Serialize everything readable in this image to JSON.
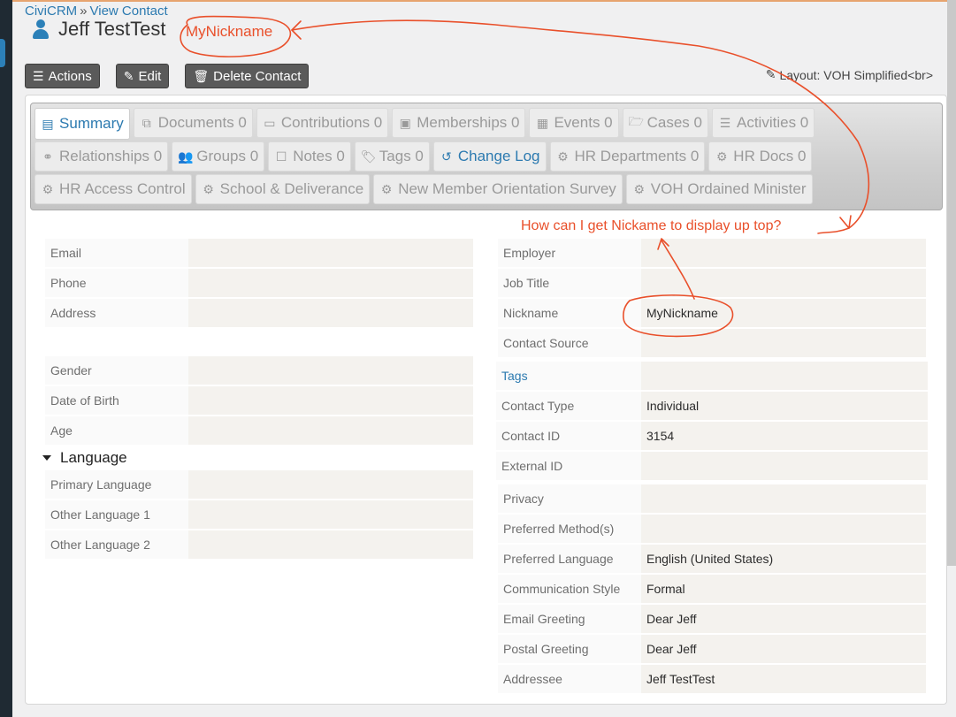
{
  "breadcrumb": {
    "root": "CiviCRM",
    "separator": "»",
    "current": "View Contact"
  },
  "contact": {
    "display_name": "Jeff TestTest"
  },
  "toolbar": {
    "actions_label": "Actions",
    "edit_label": "Edit",
    "delete_label": "Delete Contact",
    "layout_label": "Layout: VOH Simplified<br>"
  },
  "tabs": [
    [
      {
        "label": "Summary",
        "icon": "id-card-icon",
        "glyph": "▤",
        "active": true
      },
      {
        "label": "Documents 0",
        "icon": "documents-icon",
        "glyph": "⧉"
      },
      {
        "label": "Contributions 0",
        "icon": "credit-card-icon",
        "glyph": "▭"
      },
      {
        "label": "Memberships 0",
        "icon": "id-badge-icon",
        "glyph": "▣"
      },
      {
        "label": "Events 0",
        "icon": "calendar-icon",
        "glyph": "▦"
      },
      {
        "label": "Cases 0",
        "icon": "folder-open-icon",
        "glyph": "🗁"
      },
      {
        "label": "Activities 0",
        "icon": "tasks-icon",
        "glyph": "☰"
      }
    ],
    [
      {
        "label": "Relationships 0",
        "icon": "handshake-icon",
        "glyph": "⚭"
      },
      {
        "label": "Groups 0",
        "icon": "users-icon",
        "glyph": "👥"
      },
      {
        "label": "Notes 0",
        "icon": "sticky-note-icon",
        "glyph": "☐"
      },
      {
        "label": "Tags 0",
        "icon": "tags-icon",
        "glyph": "🏷"
      },
      {
        "label": "Change Log",
        "icon": "history-icon",
        "glyph": "↺",
        "link": true
      },
      {
        "label": "HR Departments 0",
        "icon": "gear-icon",
        "glyph": "⚙"
      },
      {
        "label": "HR Docs 0",
        "icon": "gear-icon",
        "glyph": "⚙"
      }
    ],
    [
      {
        "label": "HR Access Control",
        "icon": "gear-icon",
        "glyph": "⚙"
      },
      {
        "label": "School & Deliverance",
        "icon": "gear-icon",
        "glyph": "⚙"
      },
      {
        "label": "New Member Orientation Survey",
        "icon": "gear-icon",
        "glyph": "⚙"
      },
      {
        "label": "VOH Ordained Minister",
        "icon": "gear-icon",
        "glyph": "⚙"
      }
    ]
  ],
  "left": {
    "communication": [
      {
        "label": "Email",
        "value": ""
      },
      {
        "label": "Phone",
        "value": ""
      },
      {
        "label": "Address",
        "value": ""
      }
    ],
    "demographics": [
      {
        "label": "Gender",
        "value": ""
      },
      {
        "label": "Date of Birth",
        "value": ""
      },
      {
        "label": "Age",
        "value": ""
      }
    ],
    "language_section": {
      "title": "Language",
      "rows": [
        {
          "label": "Primary Language",
          "value": ""
        },
        {
          "label": "Other Language 1",
          "value": ""
        },
        {
          "label": "Other Language 2",
          "value": ""
        }
      ]
    }
  },
  "right": {
    "employment": [
      {
        "label": "Employer",
        "value": ""
      },
      {
        "label": "Job Title",
        "value": ""
      },
      {
        "label": "Nickname",
        "value": "MyNickname"
      },
      {
        "label": "Contact Source",
        "value": ""
      }
    ],
    "basic": [
      {
        "label": "Tags",
        "value": "",
        "link": true
      },
      {
        "label": "Contact Type",
        "value": "Individual"
      },
      {
        "label": "Contact ID",
        "value": "3154"
      },
      {
        "label": "External ID",
        "value": ""
      }
    ],
    "preferences": [
      {
        "label": "Privacy",
        "value": ""
      },
      {
        "label": "Preferred Method(s)",
        "value": ""
      },
      {
        "label": "Preferred Language",
        "value": "English (United States)"
      },
      {
        "label": "Communication Style",
        "value": "Formal"
      },
      {
        "label": "Email Greeting",
        "value": "Dear Jeff"
      },
      {
        "label": "Postal Greeting",
        "value": "Dear Jeff"
      },
      {
        "label": "Addressee",
        "value": "Jeff TestTest"
      }
    ]
  },
  "annotations": {
    "title_note": "MyNickname",
    "question": "How can I get Nickame to display up top?",
    "color": "#e9502b"
  }
}
